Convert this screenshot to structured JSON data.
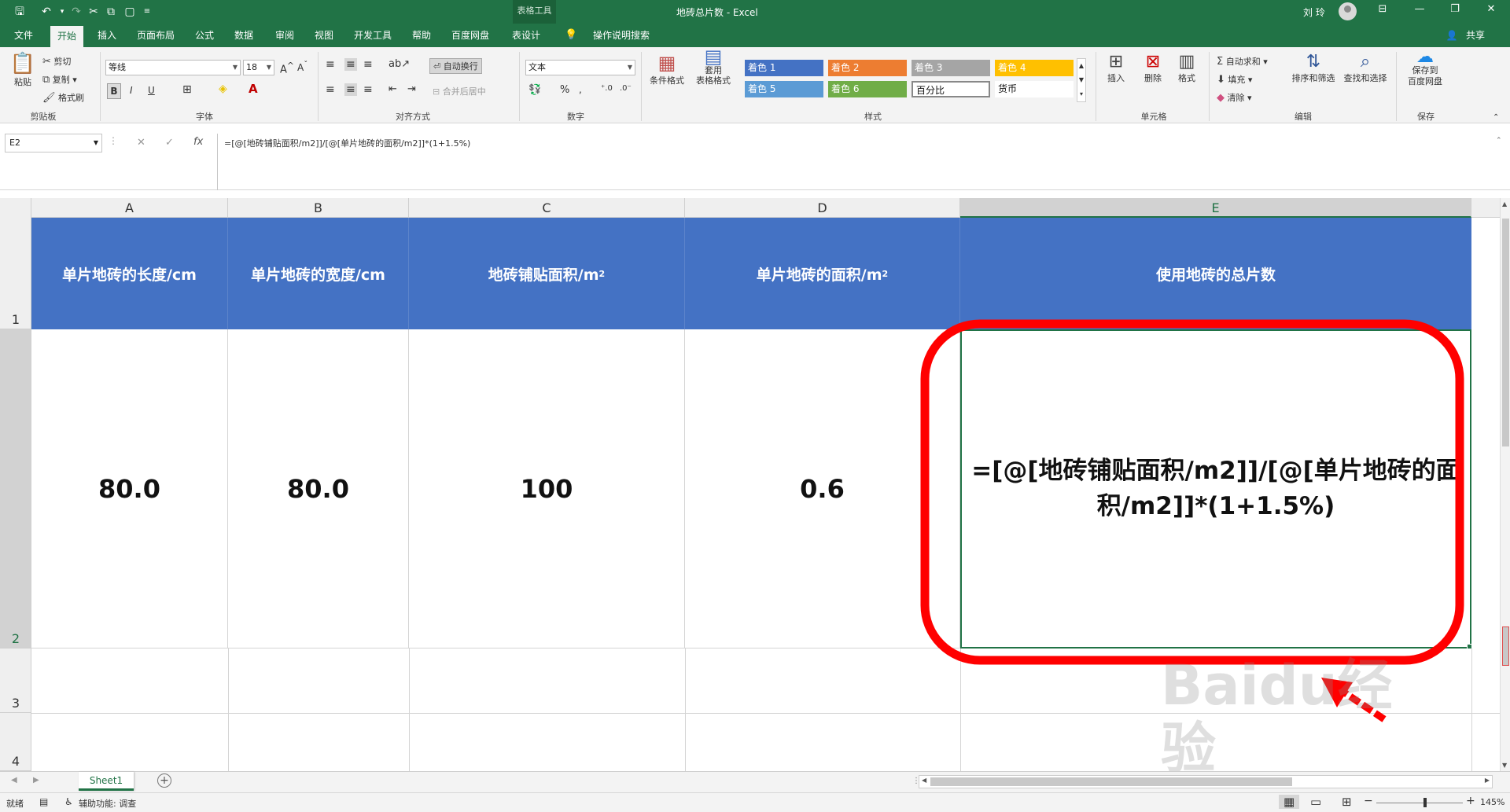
{
  "titlebar": {
    "context_tab": "表格工具",
    "document_title": "地砖总片数 - Excel",
    "user_name": "刘 玲"
  },
  "tabs": [
    "文件",
    "开始",
    "插入",
    "页面布局",
    "公式",
    "数据",
    "审阅",
    "视图",
    "开发工具",
    "帮助",
    "百度网盘",
    "表设计",
    "操作说明搜索"
  ],
  "share_label": "共享",
  "ribbon": {
    "clipboard": {
      "paste": "粘贴",
      "cut": "剪切",
      "copy": "复制",
      "format_painter": "格式刷",
      "label": "剪贴板"
    },
    "font": {
      "name": "等线",
      "size": "18",
      "bold": "B",
      "italic": "I",
      "underline": "U",
      "label": "字体"
    },
    "alignment": {
      "wrap_text": "自动换行",
      "merge_center": "合并后居中",
      "label": "对齐方式"
    },
    "number": {
      "format": "文本",
      "percent": "%",
      "label": "数字"
    },
    "styles": {
      "conditional": "条件格式",
      "table_format_line1": "套用",
      "table_format_line2": "表格格式",
      "label": "样式",
      "cells": [
        {
          "text": "着色 1",
          "color": "#4472c4"
        },
        {
          "text": "着色 2",
          "color": "#ed7d31"
        },
        {
          "text": "着色 3",
          "color": "#a5a5a5"
        },
        {
          "text": "着色 4",
          "color": "#ffc000"
        },
        {
          "text": "着色 5",
          "color": "#5b9bd5"
        },
        {
          "text": "着色 6",
          "color": "#70ad47"
        },
        {
          "text": "百分比",
          "color": "#ffffff"
        },
        {
          "text": "货币",
          "color": "#ffffff"
        }
      ]
    },
    "cells_group": {
      "insert": "插入",
      "delete": "删除",
      "format": "格式",
      "label": "单元格"
    },
    "editing": {
      "autosum": "自动求和",
      "fill": "填充",
      "clear": "清除",
      "sort_filter": "排序和筛选",
      "find_select": "查找和选择",
      "label": "编辑"
    },
    "save": {
      "line1": "保存到",
      "line2": "百度网盘",
      "label": "保存"
    }
  },
  "formula_bar": {
    "name_box": "E2",
    "formula": "=[@[地砖铺贴面积/m2]]/[@[单片地砖的面积/m2]]*(1+1.5%)"
  },
  "columns": [
    "A",
    "B",
    "C",
    "D",
    "E"
  ],
  "rows": [
    "1",
    "2",
    "3",
    "4"
  ],
  "header_row": [
    {
      "text": "单片地砖的长度/cm",
      "sup": ""
    },
    {
      "text": "单片地砖的宽度/cm",
      "sup": ""
    },
    {
      "text": "地砖铺贴面积/m",
      "sup": "2"
    },
    {
      "text": "单片地砖的面积/m",
      "sup": "2"
    },
    {
      "text": "使用地砖的总片数",
      "sup": ""
    }
  ],
  "data_row": [
    "80.0",
    "80.0",
    "100",
    "0.6",
    "=[@[地砖铺贴面积/m2]]/[@[单片地砖的面积/m2]]*(1+1.5%)"
  ],
  "sheet_tabs": [
    "Sheet1"
  ],
  "status": {
    "ready": "就绪",
    "accessibility": "辅助功能: 调查",
    "zoom": "145%"
  },
  "watermark": "Baidu经验 jingyan.baidu.com",
  "colors": {
    "excel_green": "#217346",
    "header_blue": "#4472c4",
    "annotation_red": "#ff0000"
  }
}
